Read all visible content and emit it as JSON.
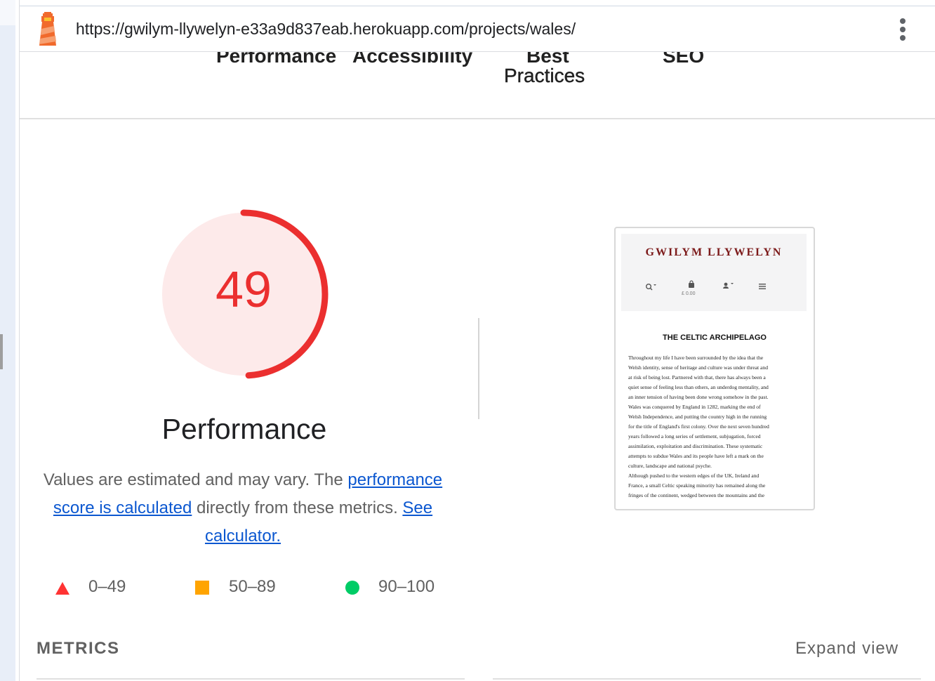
{
  "browser": {
    "url": "https://gwilym-llywelyn-e33a9d837eab.herokuapp.com/projects/wales/",
    "menu_icon": "kebab-menu-icon",
    "logo_icon": "lighthouse-icon"
  },
  "categories": {
    "performance": "Performance",
    "accessibility": "Accessibility",
    "best_practices_line1": "Best",
    "best_practices_line2": "Practices",
    "seo": "SEO"
  },
  "gauge": {
    "score": "49",
    "score_fraction": 0.49,
    "title": "Performance",
    "color": "#eb2f2f",
    "fill_color": "#fdeaea"
  },
  "description": {
    "text_before": "Values are estimated and may vary. The ",
    "link1": "performance score is calculated",
    "text_middle": " directly from these metrics. ",
    "link2": "See calculator."
  },
  "legend": [
    {
      "range": "0–49",
      "shape": "triangle",
      "color": "#f33"
    },
    {
      "range": "50–89",
      "shape": "square",
      "color": "#ffa400"
    },
    {
      "range": "90–100",
      "shape": "circle",
      "color": "#0c6"
    }
  ],
  "screenshot": {
    "brand": "GWILYM LLYWELYN",
    "price": "£ 0.00",
    "heading": "THE CELTIC ARCHIPELAGO",
    "body_lines": [
      "Throughout my life I have been surrounded by the idea that the",
      "Welsh identity, sense of heritage and culture was under threat and",
      "at risk of being lost. Partnered with that, there has always been a",
      "quiet sense of feeling less than others, an underdog mentality, and",
      "an inner tension of having been done wrong somehow in the past.",
      "Wales was conquered by England in 1282, marking the end of",
      "Welsh Independence, and putting the country high in the running",
      "for the title of England's first colony. Over the next seven hundred",
      "years followed a long series of settlement, subjugation, forced",
      "assimilation, exploitation and discrimination. These systematic",
      "attempts to subdue Wales and its people have left a mark on the",
      "culture, landscape and national psyche.",
      "Although pushed to the western edges of the UK, Ireland and",
      "France, a small Celtic speaking minority has remained along the",
      "fringes of the continent, wedged between the mountains and the"
    ]
  },
  "metrics": {
    "label": "METRICS",
    "expand": "Expand view"
  }
}
